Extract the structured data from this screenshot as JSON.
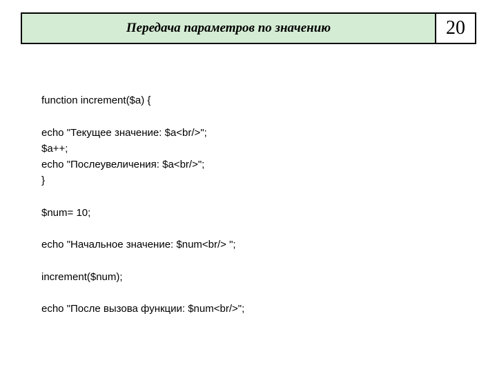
{
  "header": {
    "title": "Передача параметров по значению",
    "page_number": "20"
  },
  "code": {
    "line1": "function increment($a) {",
    "line2": "",
    "line3": "echo \"Текущее значение: $a<br/>\";",
    "line4": "$a++;",
    "line5": "echo \"Послеувеличения: $a<br/>\";",
    "line6": "}",
    "line7": "",
    "line8": "$num= 10;",
    "line9": "",
    "line10": "echo \"Начальное значение: $num<br/> \";",
    "line11": "",
    "line12": "increment($num);",
    "line13": "",
    "line14": "echo \"После вызова функции: $num<br/>\";"
  }
}
